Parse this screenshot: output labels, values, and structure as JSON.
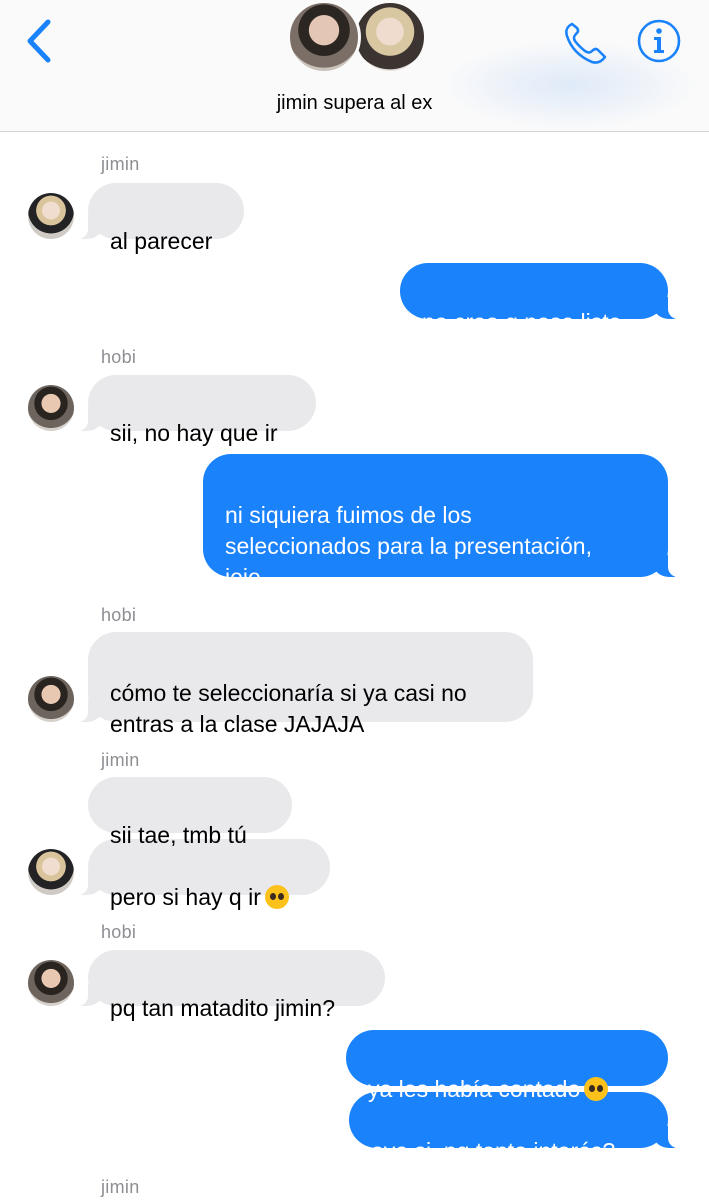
{
  "header": {
    "title": "jimin supera al ex",
    "icons": {
      "back": "chevron-left-icon",
      "call": "phone-icon",
      "info": "info-icon"
    },
    "accent_color": "#1a82fb"
  },
  "messages": [
    {
      "sender": "jimin",
      "text": "al parecer",
      "direction": "incoming"
    },
    {
      "text": "no creo q pase lista",
      "direction": "outgoing"
    },
    {
      "sender": "hobi",
      "text": "sii, no hay que ir",
      "direction": "incoming"
    },
    {
      "text": "ni siquiera fuimos de los\nseleccionados para la presentación,\njeje",
      "direction": "outgoing"
    },
    {
      "sender": "hobi",
      "text": "cómo te seleccionaría si ya casi no\nentras a la clase JAJAJA",
      "direction": "incoming"
    },
    {
      "sender": "jimin",
      "text": "sii tae, tmb tú",
      "direction": "incoming"
    },
    {
      "text": "pero si hay q ir",
      "emoji": "pleading-face-emoji",
      "direction": "incoming"
    },
    {
      "sender": "hobi",
      "text": "pq tan matadito jimin?",
      "direction": "incoming"
    },
    {
      "text": "ya les había contado",
      "emoji": "flushed-face-emoji",
      "direction": "outgoing"
    },
    {
      "text": "oye si, pq tanto interés?",
      "direction": "outgoing"
    },
    {
      "sender": "jimin",
      "direction": "incoming"
    }
  ],
  "colors": {
    "incoming_bubble": "#e9e9eb",
    "outgoing_bubble": "#1a82fb",
    "sender_name": "#8e8e93"
  }
}
